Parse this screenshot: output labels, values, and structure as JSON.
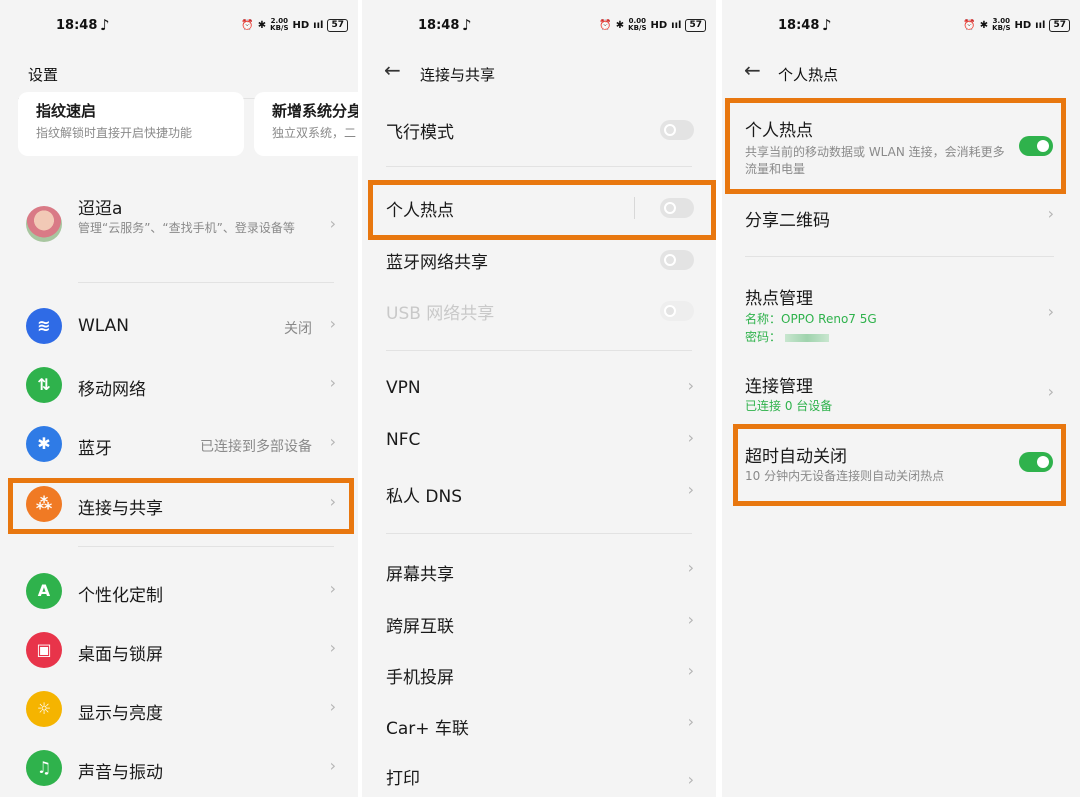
{
  "status": {
    "time": "18:48",
    "note_glyph": "♪",
    "battery": "57",
    "alarm_glyph": "⏰",
    "bt_glyph": "✱",
    "hd": "HD",
    "signal": "ııl"
  },
  "speeds": {
    "p1": "2.00",
    "p2": "0.00",
    "p3": "3.00",
    "unit": "KB/S"
  },
  "panel1": {
    "title": "设置",
    "cards": [
      {
        "title": "指纹速启",
        "desc": "指纹解锁时直接开启快捷功能"
      },
      {
        "title": "新增系统分身",
        "desc": "独立双系统，二"
      }
    ],
    "account": {
      "name": "迢迢a",
      "desc": "管理“云服务”、“查找手机”、登录设备等"
    },
    "items": [
      {
        "label": "WLAN",
        "value": "关闭",
        "icon": "wifi-icon",
        "color": "#2f6be6"
      },
      {
        "label": "移动网络",
        "value": "",
        "icon": "mobile-data-icon",
        "color": "#2fb24c"
      },
      {
        "label": "蓝牙",
        "value": "已连接到多部设备",
        "icon": "bluetooth-icon",
        "color": "#2f7be6"
      },
      {
        "label": "连接与共享",
        "value": "",
        "icon": "share-icon",
        "color": "#f07a24"
      },
      {
        "label": "个性化定制",
        "value": "",
        "icon": "personalize-icon",
        "color": "#2fb24c"
      },
      {
        "label": "桌面与锁屏",
        "value": "",
        "icon": "wallpaper-icon",
        "color": "#e8344a"
      },
      {
        "label": "显示与亮度",
        "value": "",
        "icon": "brightness-icon",
        "color": "#f5b400"
      },
      {
        "label": "声音与振动",
        "value": "",
        "icon": "sound-icon",
        "color": "#2fb24c"
      }
    ]
  },
  "panel2": {
    "title": "连接与共享",
    "toggles": [
      {
        "label": "飞行模式"
      },
      {
        "label": "个人热点"
      },
      {
        "label": "蓝牙网络共享"
      },
      {
        "label": "USB 网络共享"
      }
    ],
    "group1": [
      "VPN",
      "NFC",
      "私人 DNS"
    ],
    "group2": [
      "屏幕共享",
      "跨屏互联",
      "手机投屏",
      "Car+ 车联",
      "打印"
    ]
  },
  "panel3": {
    "title": "个人热点",
    "hotspot": {
      "label": "个人热点",
      "desc": "共享当前的移动数据或 WLAN 连接，会消耗更多流量和电量"
    },
    "qr": {
      "label": "分享二维码"
    },
    "manage": {
      "label": "热点管理",
      "name_line": "名称：OPPO Reno7 5G",
      "pwd_line": "密码："
    },
    "conn": {
      "label": "连接管理",
      "sub": "已连接 0 台设备"
    },
    "auto_off": {
      "label": "超时自动关闭",
      "desc": "10 分钟内无设备连接则自动关闭热点"
    }
  },
  "colors": {
    "highlight": "#e8770f",
    "green": "#2fb24c"
  }
}
